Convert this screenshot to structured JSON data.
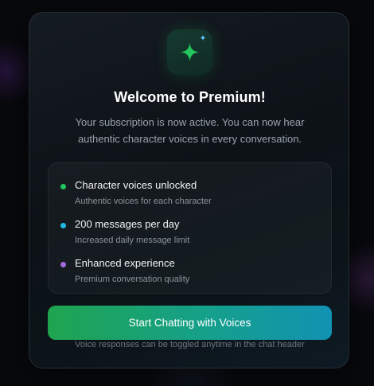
{
  "modal": {
    "icon": "sparkle-icon",
    "title": "Welcome to Premium!",
    "subtitle": "Your subscription is now active. You can now hear authentic character voices in every conversation.",
    "features": [
      {
        "title": "Character voices unlocked",
        "description": "Authentic voices for each character",
        "dot_color": "#22c55e"
      },
      {
        "title": "200 messages per day",
        "description": "Increased daily message limit",
        "dot_color": "#22b8e6"
      },
      {
        "title": "Enhanced experience",
        "description": "Premium conversation quality",
        "dot_color": "#a26be0"
      }
    ],
    "cta_label": "Start Chatting with Voices",
    "footnote": "Voice responses can be toggled anytime in the chat header"
  },
  "colors": {
    "accent_green": "#22c55e",
    "accent_cyan": "#1192b3",
    "sparkle_small": "#5ec8ff"
  }
}
